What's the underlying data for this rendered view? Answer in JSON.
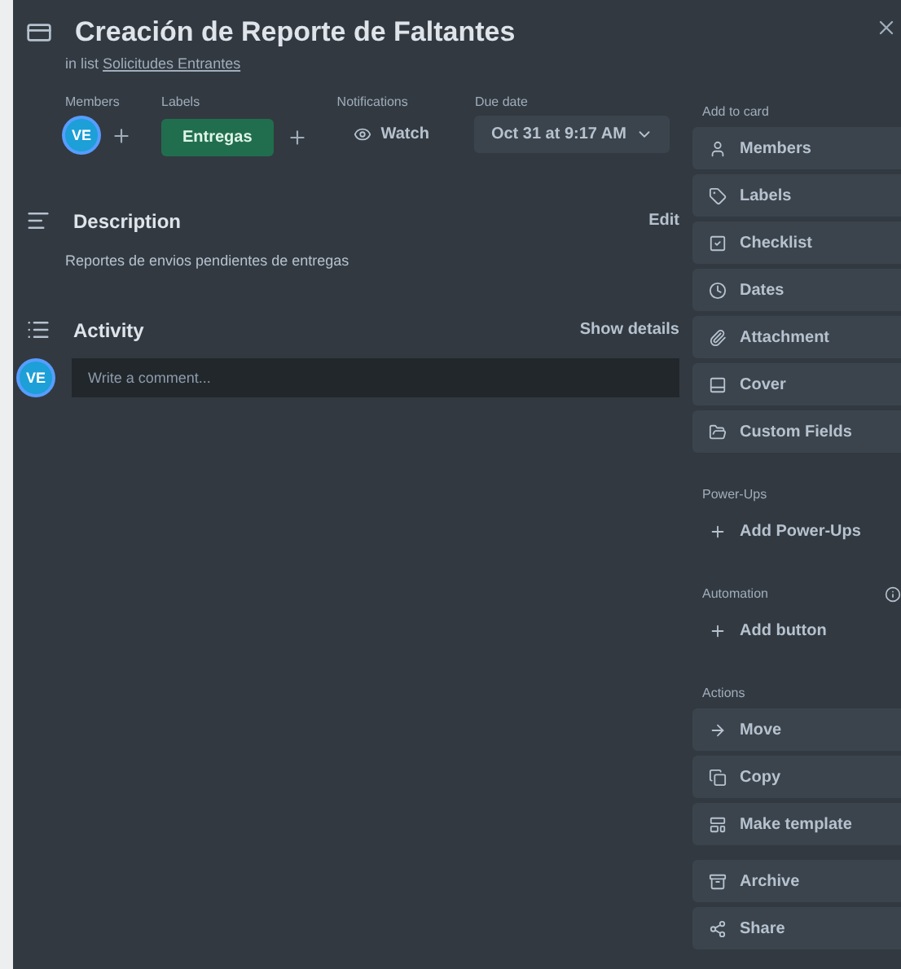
{
  "card": {
    "title": "Creación de Reporte de Faltantes",
    "list_prefix": "in list",
    "list_name": "Solicitudes Entrantes"
  },
  "header_fields": {
    "members_label": "Members",
    "member_initials": "VE",
    "labels_label": "Labels",
    "labels": [
      {
        "text": "Entregas",
        "color": "#216e4e"
      }
    ],
    "notifications_label": "Notifications",
    "watch": "Watch",
    "due_label": "Due date",
    "due": "Oct 31 at 9:17 AM"
  },
  "description": {
    "heading": "Description",
    "edit": "Edit",
    "text": "Reportes de envios pendientes de entregas"
  },
  "activity": {
    "heading": "Activity",
    "show_details": "Show details",
    "avatar": "VE",
    "placeholder": "Write a comment..."
  },
  "sidebar": [
    {
      "heading": "Add to card",
      "items": [
        {
          "label": "Members",
          "kind": "button"
        },
        {
          "label": "Labels",
          "kind": "button"
        },
        {
          "label": "Checklist",
          "kind": "button"
        },
        {
          "label": "Dates",
          "kind": "button"
        },
        {
          "label": "Attachment",
          "kind": "button"
        },
        {
          "label": "Cover",
          "kind": "button"
        },
        {
          "label": "Custom Fields",
          "kind": "button"
        }
      ]
    },
    {
      "heading": "Power-Ups",
      "items": [
        {
          "label": "Add Power-Ups",
          "kind": "link"
        }
      ]
    },
    {
      "heading": "Automation",
      "items": [
        {
          "label": "Add button",
          "kind": "link"
        }
      ]
    },
    {
      "heading": "Actions",
      "items": [
        {
          "label": "Move",
          "kind": "button"
        },
        {
          "label": "Copy",
          "kind": "button"
        },
        {
          "label": "Make template",
          "kind": "button"
        },
        {
          "label": "Archive",
          "kind": "button"
        },
        {
          "label": "Share",
          "kind": "button"
        }
      ]
    }
  ]
}
